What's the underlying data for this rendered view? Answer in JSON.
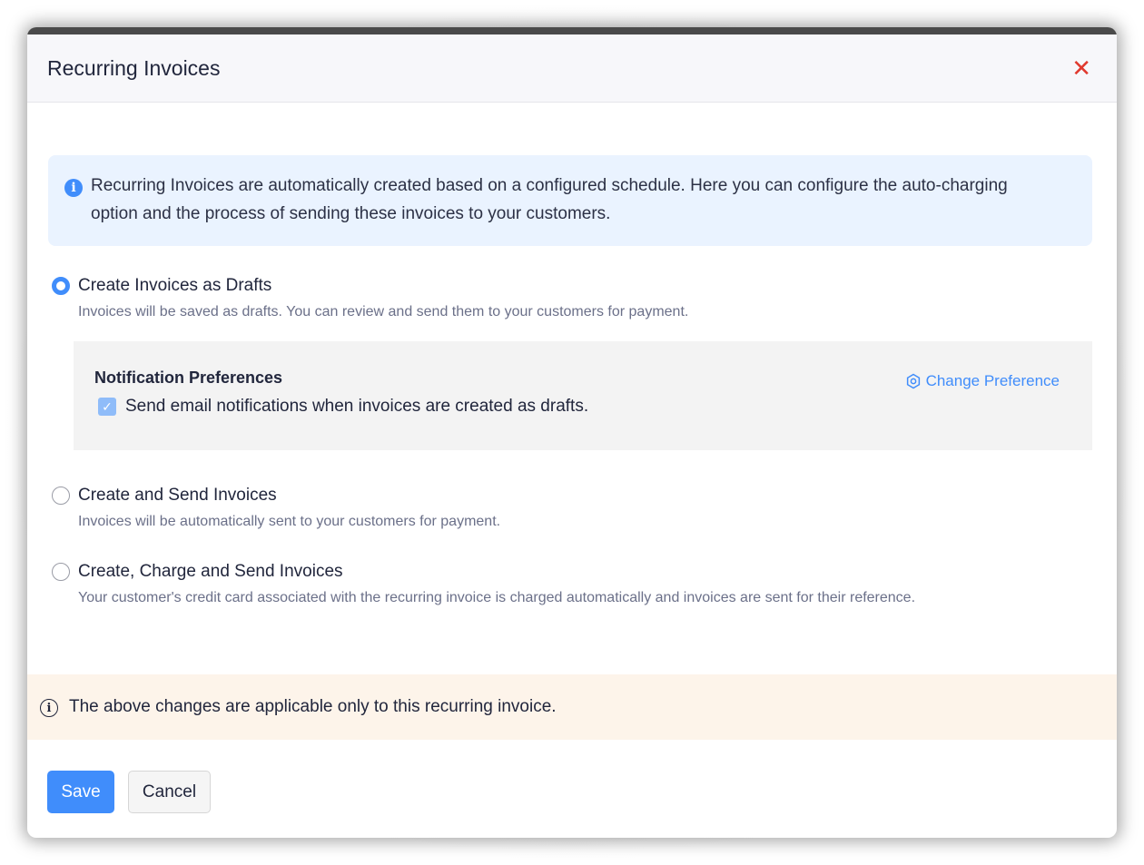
{
  "modal": {
    "title": "Recurring Invoices",
    "close_glyph": "✕"
  },
  "info": {
    "text": "Recurring Invoices are automatically created based on a configured schedule. Here you can configure the auto-charging option and the process of sending these invoices to your customers."
  },
  "options": [
    {
      "label": "Create Invoices as Drafts",
      "description": "Invoices will be saved as drafts. You can review and send them to your customers for payment.",
      "selected": true
    },
    {
      "label": "Create and Send Invoices",
      "description": "Invoices will be automatically sent to your customers for payment.",
      "selected": false
    },
    {
      "label": "Create, Charge and Send Invoices",
      "description": "Your customer's credit card associated with the recurring invoice is charged automatically and invoices are sent for their reference.",
      "selected": false
    }
  ],
  "preferences": {
    "title": "Notification Preferences",
    "checkbox_label": "Send email notifications when invoices are created as drafts.",
    "checked": true,
    "change_link": "Change Preference"
  },
  "notice": {
    "text": "The above changes are applicable only to this recurring invoice."
  },
  "footer": {
    "save_label": "Save",
    "cancel_label": "Cancel"
  },
  "colors": {
    "accent": "#408dfb",
    "close": "#e0392e",
    "info_bg": "#eaf3ff",
    "notice_bg": "#fdf4ea"
  }
}
